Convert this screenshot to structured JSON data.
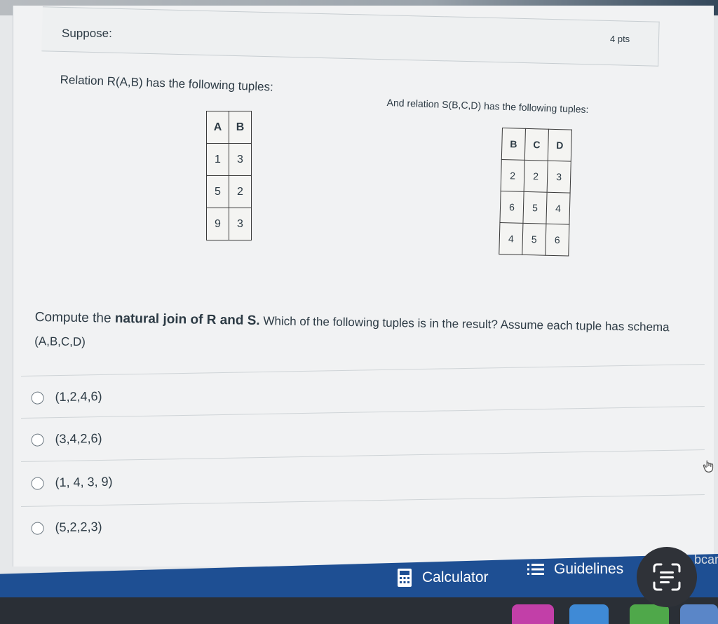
{
  "question": {
    "heading": "Suppose:",
    "points": "4 pts",
    "relation_r_text": "Relation R(A,B) has the following tuples:",
    "relation_s_text": "And relation S(B,C,D) has the following tuples:",
    "prompt_prefix": "Compute the ",
    "prompt_bold": "natural join of R and S.",
    "prompt_suffix": " Which of the following tuples is in the result? Assume each tuple has schema (A,B,C,D)"
  },
  "relation_r": {
    "headers": [
      "A",
      "B"
    ],
    "rows": [
      [
        "1",
        "3"
      ],
      [
        "5",
        "2"
      ],
      [
        "9",
        "3"
      ]
    ]
  },
  "relation_s": {
    "headers": [
      "B",
      "C",
      "D"
    ],
    "rows": [
      [
        "2",
        "2",
        "3"
      ],
      [
        "6",
        "5",
        "4"
      ],
      [
        "4",
        "5",
        "6"
      ]
    ]
  },
  "answers": [
    {
      "label": "(1,2,4,6)"
    },
    {
      "label": "(3,4,2,6)"
    },
    {
      "label": "(1, 4, 3, 9)"
    },
    {
      "label": "(5,2,2,3)"
    }
  ],
  "footer": {
    "calculator_label": "Calculator",
    "guidelines_label": "Guidelines",
    "edge_text": "bcar"
  },
  "colors": {
    "footer_blue": "#1e4f93",
    "text": "#2d3b45"
  },
  "icons": [
    "calculator-icon",
    "list-icon",
    "lens-scan-icon",
    "hand-cursor-icon",
    "radio-empty-icon"
  ]
}
